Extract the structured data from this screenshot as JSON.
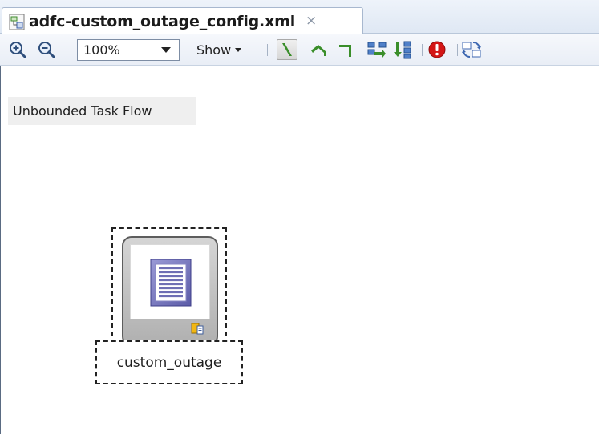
{
  "editor_tab": {
    "title": "adfc-custom_outage_config.xml",
    "close_glyph": "×",
    "icon": "xml-diagram-file-icon"
  },
  "toolbar": {
    "zoom_in_icon": "zoom-in-icon",
    "zoom_out_icon": "zoom-out-icon",
    "zoom_value": "100%",
    "show_label": "Show",
    "connector_styles": [
      "straight-connector-icon",
      "angled-connector-icon",
      "orthogonal-connector-icon"
    ],
    "layout_icons": [
      "layout-horizontal-icon",
      "layout-vertical-icon"
    ],
    "error_icon": "error-icon",
    "refresh_icon": "refresh-icon"
  },
  "diagram": {
    "flow_title": "Unbounded Task Flow",
    "activities": [
      {
        "label": "custom_outage",
        "type": "view",
        "selected": true
      }
    ]
  },
  "colors": {
    "tab_strip": "#dfe8f4",
    "toolbar": "#e9eef6",
    "accent_green": "#3a8e2a",
    "error_red": "#d41616",
    "view_blue": "#6f6fb4"
  }
}
